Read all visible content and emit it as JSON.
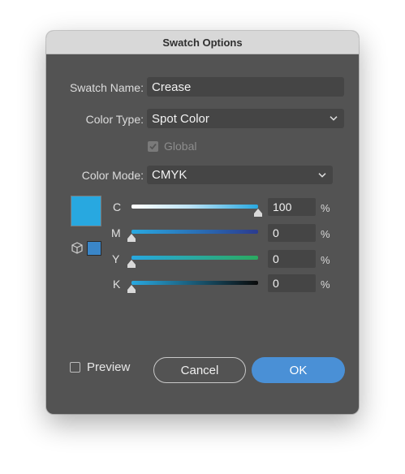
{
  "dialog": {
    "title": "Swatch Options",
    "swatch_name": {
      "label": "Swatch Name:",
      "value": "Crease"
    },
    "color_type": {
      "label": "Color Type:",
      "value": "Spot Color"
    },
    "global": {
      "label": "Global",
      "checked": true,
      "enabled": false
    },
    "color_mode": {
      "label": "Color Mode:",
      "value": "CMYK"
    },
    "swatch_color": "#28a8e0",
    "channels": [
      {
        "letter": "C",
        "value": "100",
        "unit": "%",
        "level": 1.0
      },
      {
        "letter": "M",
        "value": "0",
        "unit": "%",
        "level": 0.0
      },
      {
        "letter": "Y",
        "value": "0",
        "unit": "%",
        "level": 0.0
      },
      {
        "letter": "K",
        "value": "0",
        "unit": "%",
        "level": 0.0
      }
    ],
    "preview": {
      "label": "Preview",
      "checked": false
    },
    "buttons": {
      "cancel": "Cancel",
      "ok": "OK"
    },
    "colors": {
      "accent": "#4a90d6",
      "panel": "#535353",
      "field": "#454545"
    }
  }
}
